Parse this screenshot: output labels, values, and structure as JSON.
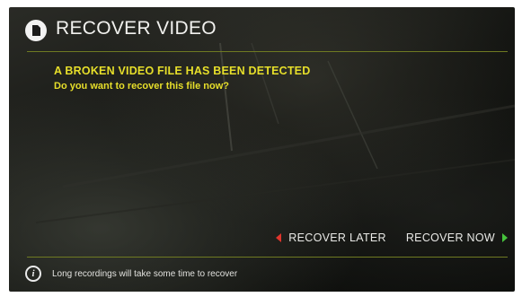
{
  "dialog": {
    "title": "RECOVER VIDEO",
    "icon": "video-file-icon",
    "message_title": "A BROKEN VIDEO FILE HAS BEEN DETECTED",
    "message_question": "Do you want to recover this file now?"
  },
  "actions": {
    "recover_later_label": "RECOVER LATER",
    "recover_now_label": "RECOVER NOW"
  },
  "footer": {
    "info_text": "Long recordings will take some time to recover",
    "icon": "info-icon"
  },
  "colors": {
    "accent_yellow": "#e7df2a",
    "rule_olive": "#6f7a22",
    "chevron_red": "#e0352c",
    "chevron_green": "#46c23c"
  }
}
